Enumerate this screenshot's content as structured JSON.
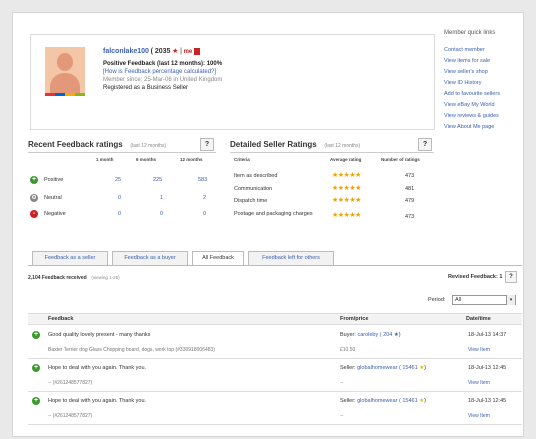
{
  "profile": {
    "username": "falconlake100",
    "score": "( 2035",
    "separator": "|",
    "me_badge": "me",
    "positive_feedback": "Positive Feedback (last 12 months): 100%",
    "calc_link": "[How is Feedback percentage calculated?]",
    "member_since": "Member since: 25-Mar-06 in United Kingdom",
    "registered": "Registered as a Business Seller"
  },
  "sidebar": {
    "header": "Member quick links",
    "items": [
      "Contact member",
      "View items for sale",
      "View seller's shop",
      "View ID History",
      "Add to favourite sellers",
      "View eBay My World",
      "View reviews & guides",
      "View About Me page"
    ]
  },
  "recent": {
    "title": "Recent Feedback ratings",
    "sub": "(last 12 months)",
    "help": "?",
    "cols": [
      "1 month",
      "6 months",
      "12 months"
    ],
    "rows": [
      {
        "label": "Positive",
        "values": [
          "25",
          "225",
          "583"
        ],
        "color": "#3a9a2c",
        "symbol": "+"
      },
      {
        "label": "Neutral",
        "values": [
          "0",
          "1",
          "2"
        ],
        "color": "#888888",
        "symbol": "o"
      },
      {
        "label": "Negative",
        "values": [
          "0",
          "0",
          "0"
        ],
        "color": "#cc2222",
        "symbol": "-"
      }
    ]
  },
  "detailed": {
    "title": "Detailed Seller Ratings",
    "sub": "(last 12 months)",
    "help": "?",
    "cols": [
      "Criteria",
      "Average rating",
      "Number of ratings"
    ],
    "rows": [
      {
        "label": "Item as described",
        "stars": "★★★★★",
        "count": "473"
      },
      {
        "label": "Communication",
        "stars": "★★★★★",
        "count": "481"
      },
      {
        "label": "Dispatch time",
        "stars": "★★★★★",
        "count": "479"
      },
      {
        "label": "Postage and packaging charges",
        "stars": "★★★★★",
        "count": "473"
      }
    ]
  },
  "tabs": [
    "Feedback as a seller",
    "Feedback as a buyer",
    "All Feedback",
    "Feedback left for others"
  ],
  "received": "2,104 Feedback received",
  "received_sub": "(viewing 1-25)",
  "revised": "Revised Feedback: 1",
  "revised_help": "?",
  "period": {
    "label": "Period:",
    "value": "All"
  },
  "table": {
    "headers": [
      "Feedback",
      "From/price",
      "Date/time"
    ],
    "rows": [
      {
        "text": "Good quality lovely present - many thanks",
        "sub": "Baxter Terrier dog Glass Chopping board, dogs, work top (#330918006483)",
        "from_role": "Buyer:",
        "from_user": "caroleby ( 204",
        "price": "£10.50",
        "date": "18-Jul-13 14:37",
        "view": "View Item"
      },
      {
        "text": "Hope to deal with you again. Thank you.",
        "sub": "-- (#261248577827)",
        "from_role": "Seller:",
        "from_user": "globalhomewear ( 15461",
        "price": "--",
        "date": "18-Jul-13 12:45",
        "view": "View Item"
      },
      {
        "text": "Hope to deal with you again. Thank you.",
        "sub": "-- (#261248577827)",
        "from_role": "Seller:",
        "from_user": "globalhomewear ( 15461",
        "price": "--",
        "date": "18-Jul-13 12:45",
        "view": "View Item"
      }
    ]
  }
}
